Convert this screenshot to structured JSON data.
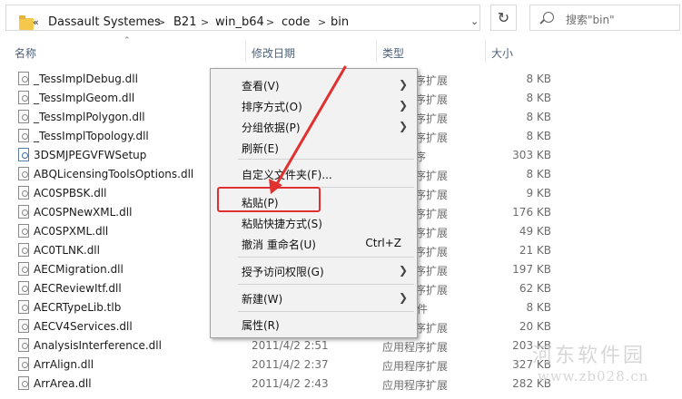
{
  "breadcrumb": {
    "prefix": "«",
    "items": [
      "Dassault Systemes",
      "B21",
      "win_b64",
      "code",
      "bin"
    ],
    "separator": ">"
  },
  "search": {
    "placeholder": "搜索\"bin\""
  },
  "columns": {
    "name": "名称",
    "date": "修改日期",
    "type": "类型",
    "size": "大小"
  },
  "files": [
    {
      "name": "_TessImplDebug.dll",
      "date": "",
      "type": "应用程序扩展",
      "size": "8 KB",
      "icon": "dll-icon"
    },
    {
      "name": "_TessImplGeom.dll",
      "date": "",
      "type": "应用程序扩展",
      "size": "8 KB",
      "icon": "dll-icon"
    },
    {
      "name": "_TessImplPolygon.dll",
      "date": "",
      "type": "应用程序扩展",
      "size": "8 KB",
      "icon": "dll-icon"
    },
    {
      "name": "_TessImplTopology.dll",
      "date": "",
      "type": "应用程序扩展",
      "size": "8 KB",
      "icon": "dll-icon"
    },
    {
      "name": "3DSMJPEGVFWSetup",
      "date": "",
      "type": "应用程序",
      "size": "303 KB",
      "icon": "exe-icon"
    },
    {
      "name": "ABQLicensingToolsOptions.dll",
      "date": "",
      "type": "应用程序扩展",
      "size": "8 KB",
      "icon": "dll-icon"
    },
    {
      "name": "AC0SPBSK.dll",
      "date": "",
      "type": "应用程序扩展",
      "size": "9 KB",
      "icon": "dll-icon"
    },
    {
      "name": "AC0SPNewXML.dll",
      "date": "",
      "type": "应用程序扩展",
      "size": "176 KB",
      "icon": "dll-icon"
    },
    {
      "name": "AC0SPXML.dll",
      "date": "",
      "type": "应用程序扩展",
      "size": "49 KB",
      "icon": "dll-icon"
    },
    {
      "name": "AC0TLNK.dll",
      "date": "",
      "type": "应用程序扩展",
      "size": "21 KB",
      "icon": "dll-icon"
    },
    {
      "name": "AECMigration.dll",
      "date": "",
      "type": "应用程序扩展",
      "size": "197 KB",
      "icon": "dll-icon"
    },
    {
      "name": "AECReviewItf.dll",
      "date": "",
      "type": "应用程序扩展",
      "size": "62 KB",
      "icon": "dll-icon"
    },
    {
      "name": "AECRTypeLib.tlb",
      "date": "",
      "type": "TLB 文件",
      "size": "8 KB",
      "icon": "tlb-icon"
    },
    {
      "name": "AECV4Services.dll",
      "date": "",
      "type": "应用程序扩展",
      "size": "20 KB",
      "icon": "dll-icon"
    },
    {
      "name": "AnalysisInterference.dll",
      "date": "2011/4/2 2:51",
      "type": "应用程序扩展",
      "size": "203 KB",
      "icon": "dll-icon"
    },
    {
      "name": "ArrAlign.dll",
      "date": "2011/4/2 2:37",
      "type": "应用程序扩展",
      "size": "327 KB",
      "icon": "dll-icon"
    },
    {
      "name": "ArrArea.dll",
      "date": "2011/4/2 2:43",
      "type": "应用程序扩展",
      "size": "282 KB",
      "icon": "dll-icon"
    }
  ],
  "context_menu": [
    {
      "label": "查看(V)",
      "submenu": true
    },
    {
      "label": "排序方式(O)",
      "submenu": true
    },
    {
      "label": "分组依据(P)",
      "submenu": true
    },
    {
      "label": "刷新(E)"
    },
    {
      "label": "自定义文件夹(F)..."
    },
    {
      "label": "粘贴(P)",
      "highlighted": true
    },
    {
      "label": "粘贴快捷方式(S)"
    },
    {
      "label": "撤消 重命名(U)",
      "shortcut": "Ctrl+Z"
    },
    {
      "label": "授予访问权限(G)",
      "submenu": true
    },
    {
      "label": "新建(W)",
      "submenu": true
    },
    {
      "label": "属性(R)"
    }
  ],
  "watermark": {
    "line1": "河东软件园",
    "line2": "www.zb028.cn"
  },
  "colors": {
    "annotation": "#e03030",
    "header_text": "#4c607a",
    "menu_bg": "#f2f2f2"
  }
}
